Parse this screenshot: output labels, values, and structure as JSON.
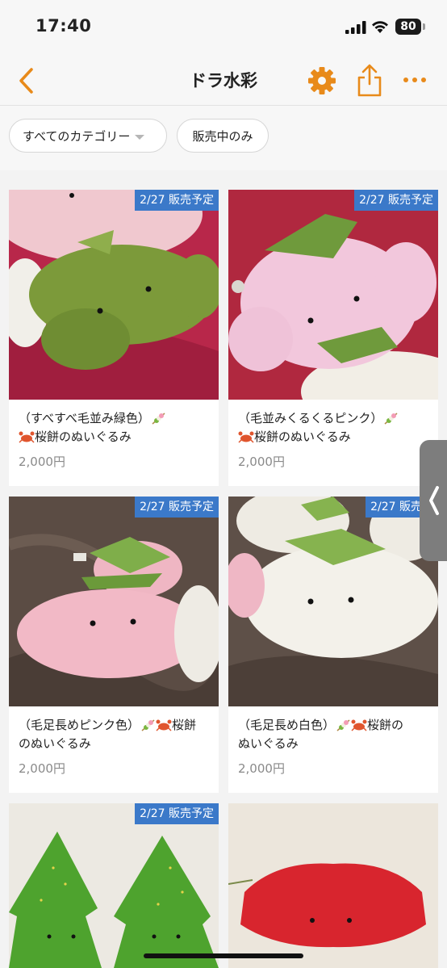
{
  "status": {
    "time": "17:40",
    "battery": "80"
  },
  "nav": {
    "title": "ドラ水彩",
    "back_icon": "chevron-left-icon",
    "settings_icon": "gear-icon",
    "share_icon": "share-icon",
    "more_icon": "more-icon",
    "accent": "#e88a1a"
  },
  "filters": {
    "category": "すべてのカテゴリー",
    "on_sale": "販売中のみ"
  },
  "items": [
    {
      "badge": "2/27 販売予定",
      "line1": "（すべすべ毛並み緑色）",
      "line2": "桜餅のぬいぐるみ",
      "price": "2,000円"
    },
    {
      "badge": "2/27 販売予定",
      "line1": "（毛並みくるくるピンク）",
      "line2": "桜餅のぬいぐるみ",
      "price": "2,000円"
    },
    {
      "badge": "2/27 販売予定",
      "line1": "（毛足長めピンク色）",
      "line1b": "桜餅",
      "line2": "のぬいぐるみ",
      "price": "2,000円"
    },
    {
      "badge": "2/27 販売予",
      "line1": "（毛足長め白色）",
      "line1b": "桜餅の",
      "line2": "ぬいぐるみ",
      "price": "2,000円"
    },
    {
      "badge": "2/27 販売予定"
    },
    {}
  ]
}
